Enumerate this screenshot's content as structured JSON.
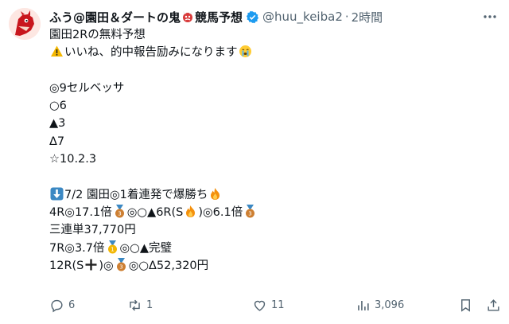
{
  "tweet": {
    "display_name": "ふう@園田＆ダートの鬼",
    "display_name_suffix": "競馬予想",
    "handle": "@huu_keiba2",
    "separator": "·",
    "time": "2時間",
    "lines": {
      "l1": "園田2Rの無料予想",
      "l2": "いいね、的中報告励みになります",
      "l4": "◎9セルベッサ",
      "l5": "○6",
      "l6": "▲3",
      "l7": "Δ7",
      "l8": "☆10.2.3",
      "l10": "7/2 園田◎1着連発で爆勝ち",
      "l11a": "4R◎17.1倍",
      "l11b": "◎○▲6R(S",
      "l11c": ")◎6.1倍",
      "l12": "三連単37,770円",
      "l13a": "7R◎3.7倍",
      "l13b": "◎○▲完璧",
      "l14a": "12R(S",
      "l14b": ")◎",
      "l14c": "◎○Δ52,320円"
    }
  },
  "actions": {
    "replies": "6",
    "reposts": "1",
    "likes": "11",
    "views": "3,096"
  },
  "colors": {
    "text": "#0f1419",
    "muted": "#536471",
    "verified": "#1d9bf0",
    "medal": "#cd7f32"
  },
  "icons": [
    "avatar",
    "demon-emoji",
    "verified-badge-icon",
    "more-icon",
    "warning-icon",
    "crying-face-icon",
    "down-arrow-icon",
    "fire-icon",
    "bronze-medal-icon",
    "gold-medal-icon",
    "plus-icon",
    "reply-icon",
    "repost-icon",
    "like-icon",
    "views-icon",
    "bookmark-icon",
    "share-icon"
  ]
}
